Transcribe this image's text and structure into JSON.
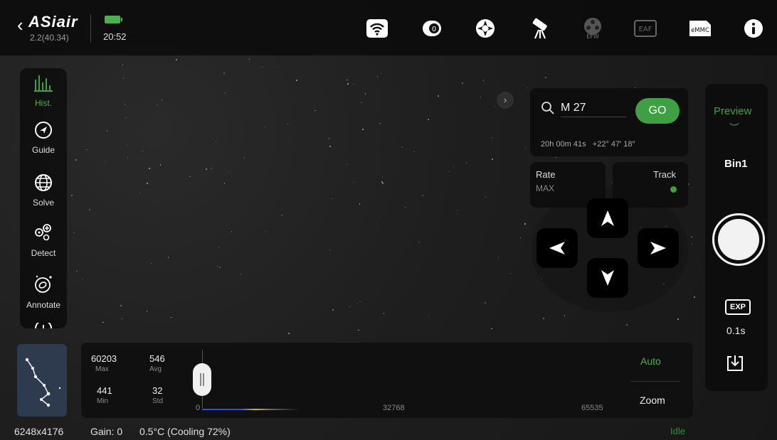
{
  "header": {
    "app_name": "ASiair",
    "version": "2.2(40.34)",
    "time": "20:52",
    "icons": [
      "wifi-icon",
      "camera-icon",
      "guide-scope-icon",
      "telescope-icon",
      "efw-icon",
      "eaf-icon",
      "emmc-icon",
      "info-icon"
    ],
    "efw_label": "EFW",
    "eaf_label": "EAF",
    "emmc_label": "eMMC"
  },
  "sidebar": {
    "items": [
      {
        "label": "Hist.",
        "icon": "histogram-icon"
      },
      {
        "label": "Guide",
        "icon": "guide-icon"
      },
      {
        "label": "Solve",
        "icon": "globe-icon"
      },
      {
        "label": "Detect",
        "icon": "detect-icon"
      },
      {
        "label": "Annotate",
        "icon": "annotate-icon"
      }
    ]
  },
  "goto": {
    "target": "M 27",
    "go_label": "GO",
    "ra": "20h 00m 41s",
    "dec": "+22° 47′ 18″"
  },
  "mount": {
    "rate_label": "Rate",
    "rate_value": "MAX",
    "track_label": "Track"
  },
  "histogram": {
    "max_value": "60203",
    "max_label": "Max",
    "avg_value": "546",
    "avg_label": "Avg",
    "min_value": "441",
    "min_label": "Min",
    "std_value": "32",
    "std_label": "Std",
    "tick_0": "0",
    "tick_mid": "32768",
    "tick_max": "65535",
    "auto_label": "Auto",
    "zoom_label": "Zoom"
  },
  "status": {
    "resolution": "6248x4176",
    "gain": "Gain: 0",
    "temp": "0.5°C (Cooling 72%)",
    "state": "Idle"
  },
  "right_panel": {
    "mode": "Preview",
    "bin": "Bin1",
    "exp_icon": "EXP",
    "exposure": "0.1s"
  },
  "colors": {
    "accent": "#3fa043",
    "bar_bg": "#0d0d0d",
    "sky_bg": "#1c1c1c"
  }
}
